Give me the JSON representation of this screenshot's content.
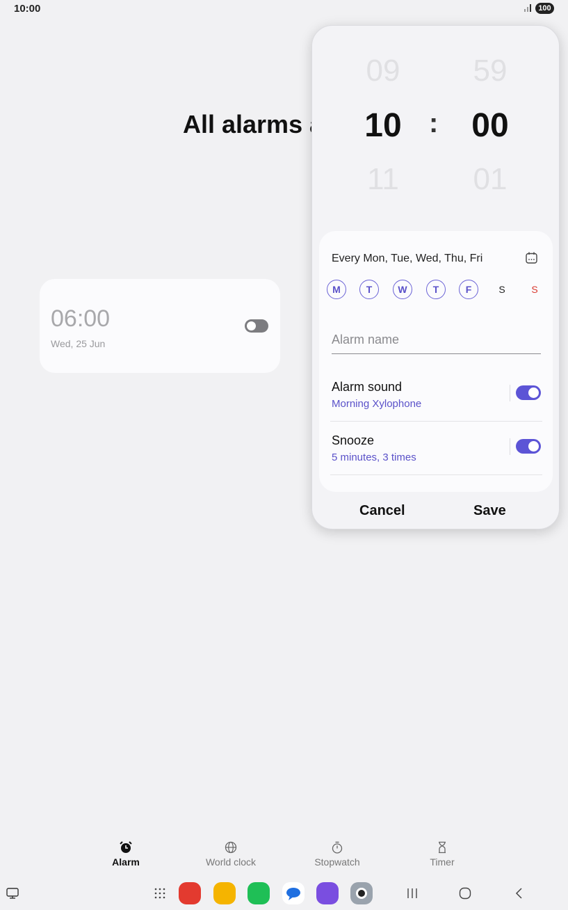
{
  "status": {
    "time": "10:00",
    "battery": "100"
  },
  "page": {
    "title": "All alarms a"
  },
  "alarm_card": {
    "time": "06:00",
    "date": "Wed, 25 Jun",
    "enabled": false
  },
  "picker": {
    "hour_prev": "09",
    "hour": "10",
    "hour_next": "11",
    "separator": ":",
    "minute_prev": "59",
    "minute": "00",
    "minute_next": "01"
  },
  "repeat": {
    "text": "Every Mon, Tue, Wed, Thu, Fri",
    "days": [
      {
        "letter": "M",
        "selected": true
      },
      {
        "letter": "T",
        "selected": true
      },
      {
        "letter": "W",
        "selected": true
      },
      {
        "letter": "T",
        "selected": true
      },
      {
        "letter": "F",
        "selected": true
      },
      {
        "letter": "S",
        "selected": false
      },
      {
        "letter": "S",
        "selected": false
      }
    ]
  },
  "alarm_name": {
    "placeholder": "Alarm name",
    "value": ""
  },
  "alarm_sound": {
    "label": "Alarm sound",
    "value": "Morning Xylophone",
    "enabled": true
  },
  "snooze": {
    "label": "Snooze",
    "value": "5 minutes, 3 times",
    "enabled": true
  },
  "actions": {
    "cancel": "Cancel",
    "save": "Save"
  },
  "tabs": [
    {
      "label": "Alarm",
      "icon": "alarm-clock-icon",
      "selected": true
    },
    {
      "label": "World clock",
      "icon": "globe-icon",
      "selected": false
    },
    {
      "label": "Stopwatch",
      "icon": "stopwatch-icon",
      "selected": false
    },
    {
      "label": "Timer",
      "icon": "hourglass-icon",
      "selected": false
    }
  ],
  "colors": {
    "accent": "#5c54d6",
    "sunday": "#d93a30",
    "background": "#f1f1f3"
  }
}
